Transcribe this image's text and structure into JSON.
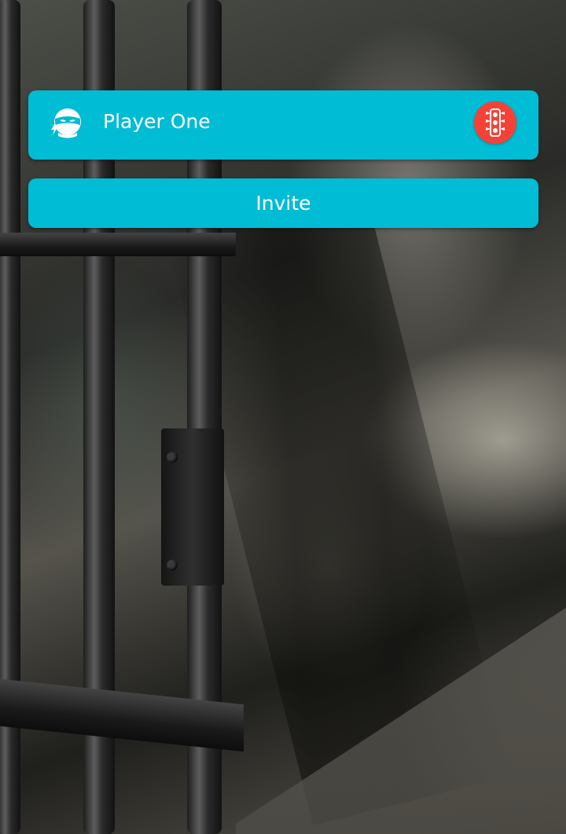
{
  "player": {
    "name": "Player One",
    "avatar_icon": "ninja-icon",
    "status_icon": "traffic-light-icon",
    "status_color": "#f44336"
  },
  "invite": {
    "label": "Invite"
  },
  "theme": {
    "accent": "#00bcd4",
    "text": "#ffffff"
  },
  "background": {
    "description_icon": "prison-bars-image"
  }
}
